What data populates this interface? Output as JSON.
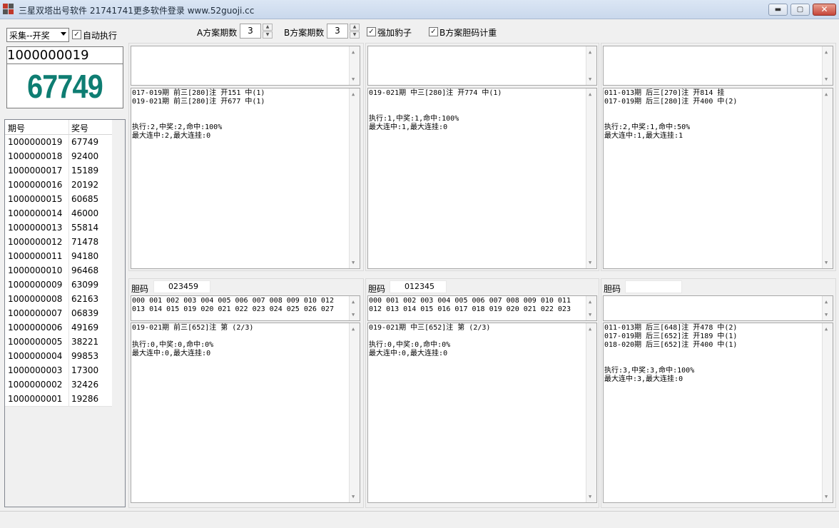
{
  "window": {
    "title": "三星双塔出号软件 21741741更多软件登录 www.52guoji.cc",
    "minimize": "▬",
    "maximize": "▢",
    "close": "✕"
  },
  "toolbar": {
    "collect_select": "采集--开奖",
    "auto_exec_label": "自动执行",
    "a_periods_label": "A方案期数",
    "a_periods_value": "3",
    "b_periods_label": "B方案期数",
    "b_periods_value": "3",
    "strong_label": "强加豹子",
    "b_weight_label": "B方案胆码计重"
  },
  "current": {
    "issue": "1000000019",
    "number": "67749"
  },
  "history": {
    "headers": [
      "期号",
      "奖号"
    ],
    "rows": [
      [
        "1000000019",
        "67749"
      ],
      [
        "1000000018",
        "92400"
      ],
      [
        "1000000017",
        "15189"
      ],
      [
        "1000000016",
        "20192"
      ],
      [
        "1000000015",
        "60685"
      ],
      [
        "1000000014",
        "46000"
      ],
      [
        "1000000013",
        "55814"
      ],
      [
        "1000000012",
        "71478"
      ],
      [
        "1000000011",
        "94180"
      ],
      [
        "1000000010",
        "96468"
      ],
      [
        "1000000009",
        "63099"
      ],
      [
        "1000000008",
        "62163"
      ],
      [
        "1000000007",
        "06839"
      ],
      [
        "1000000006",
        "49169"
      ],
      [
        "1000000005",
        "38221"
      ],
      [
        "1000000004",
        "99853"
      ],
      [
        "1000000003",
        "17300"
      ],
      [
        "1000000002",
        "32426"
      ],
      [
        "1000000001",
        "19286"
      ]
    ]
  },
  "panels_top": [
    {
      "input_text": "",
      "result_text": "017-019期 前三[280]注 开151 中(1)\n019-021期 前三[280]注 开677 中(1)\n\n\n执行:2,中奖:2,命中:100%\n最大连中:2,最大连挂:0"
    },
    {
      "input_text": "",
      "result_text": "019-021期 中三[280]注 开774 中(1)\n\n\n执行:1,中奖:1,命中:100%\n最大连中:1,最大连挂:0"
    },
    {
      "input_text": "",
      "result_text": "011-013期 后三[270]注 开814 挂\n017-019期 后三[280]注 开400 中(2)\n\n\n执行:2,中奖:1,命中:50%\n最大连中:1,最大连挂:1"
    }
  ],
  "panels_bottom": [
    {
      "dan_label": "胆码",
      "dan_value": "023459",
      "combos_text": "000 001 002 003 004 005 006 007 008 009 010 012\n013 014 015 019 020 021 022 023 024 025 026 027",
      "result_text": "019-021期 前三[652]注 第 (2/3)\n\n执行:0,中奖:0,命中:0%\n最大连中:0,最大连挂:0"
    },
    {
      "dan_label": "胆码",
      "dan_value": "012345",
      "combos_text": "000 001 002 003 004 005 006 007 008 009 010 011\n012 013 014 015 016 017 018 019 020 021 022 023",
      "result_text": "019-021期 中三[652]注 第 (2/3)\n\n执行:0,中奖:0,命中:0%\n最大连中:0,最大连挂:0"
    },
    {
      "dan_label": "胆码",
      "dan_value": "",
      "combos_text": "",
      "result_text": "011-013期 后三[648]注 开478 中(2)\n017-019期 后三[652]注 开189 中(1)\n018-020期 后三[652]注 开400 中(1)\n\n\n执行:3,中奖:3,命中:100%\n最大连中:3,最大连挂:0"
    }
  ],
  "colors": {
    "number_color": "#0e7d72"
  }
}
